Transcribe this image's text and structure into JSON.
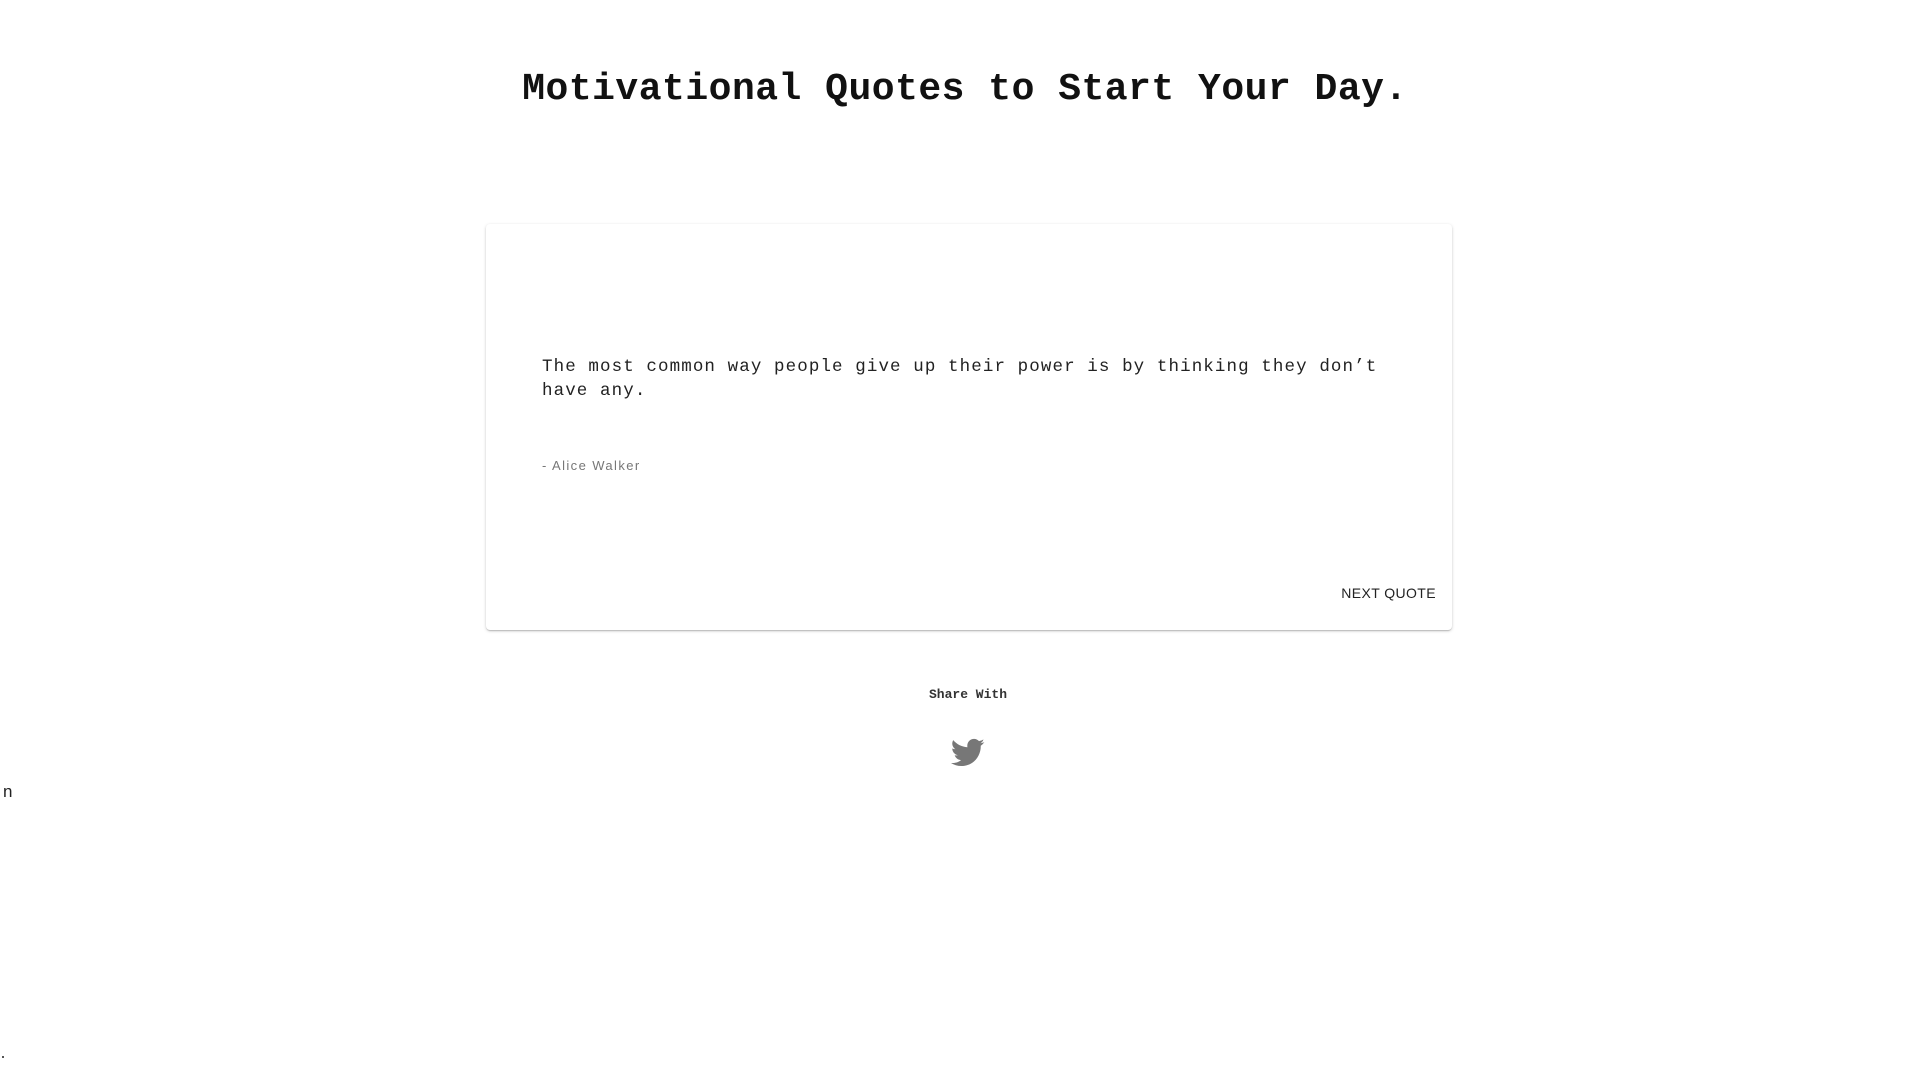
{
  "header": {
    "title": "Motivational Quotes to Start Your Day."
  },
  "quote_card": {
    "quote": "The most common way people give up their power is by thinking they don’t have any.",
    "author": "- Alice Walker",
    "next_button_label": "NEXT QUOTE"
  },
  "share": {
    "label": "Share With",
    "icon": "twitter-icon",
    "icon_color": "#777777"
  },
  "stray": {
    "text": "n"
  }
}
